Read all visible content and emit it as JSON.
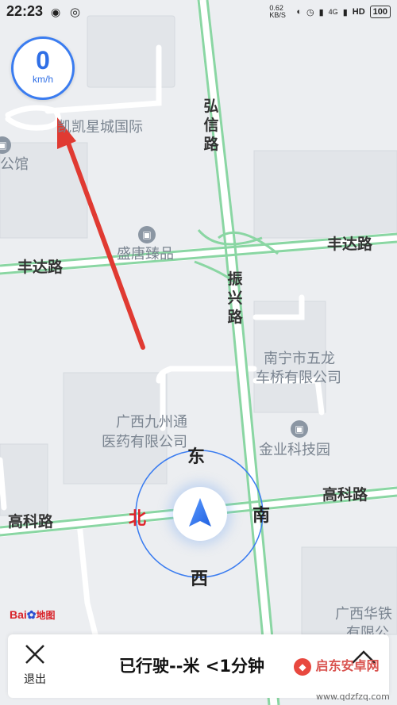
{
  "status_bar": {
    "time": "22:23",
    "net_speed": "0.62 KB/S",
    "signal_4g": "4G",
    "hd": "HD",
    "battery": "100"
  },
  "speedometer": {
    "value": "0",
    "unit": "km/h"
  },
  "map": {
    "roads": {
      "hongxin": "弘信路",
      "fengda_right": "丰达路",
      "fengda_left": "丰达路",
      "zhenxing": "振兴路",
      "gaoke_right": "高科路",
      "gaoke_left": "高科路"
    },
    "pois": {
      "kaixing": "凯凯星城国际",
      "gongguan": "公馆",
      "shengtang": "盛唐臻品",
      "wulong_1": "南宁市五龙",
      "wulong_2": "车桥有限公司",
      "jiuzhou_1": "广西九州通",
      "jiuzhou_2": "医药有限公司",
      "jinye": "金业科技园",
      "huaxin_1": "广西华铁",
      "huaxin_2": "有限公"
    }
  },
  "compass": {
    "east": "东",
    "south": "南",
    "west": "西",
    "north": "北"
  },
  "logo": {
    "bai": "Bai",
    "du": "地图"
  },
  "bottom_bar": {
    "exit_label": "退出",
    "trip_text": "已行驶--米 <1分钟"
  },
  "watermark": {
    "text": "启东安卓网",
    "url": "www.qdzfzq.com"
  },
  "colors": {
    "accent": "#2f6fe6",
    "road": "#7fd49a",
    "arrow": "#e03a32",
    "north": "#e0232a"
  }
}
